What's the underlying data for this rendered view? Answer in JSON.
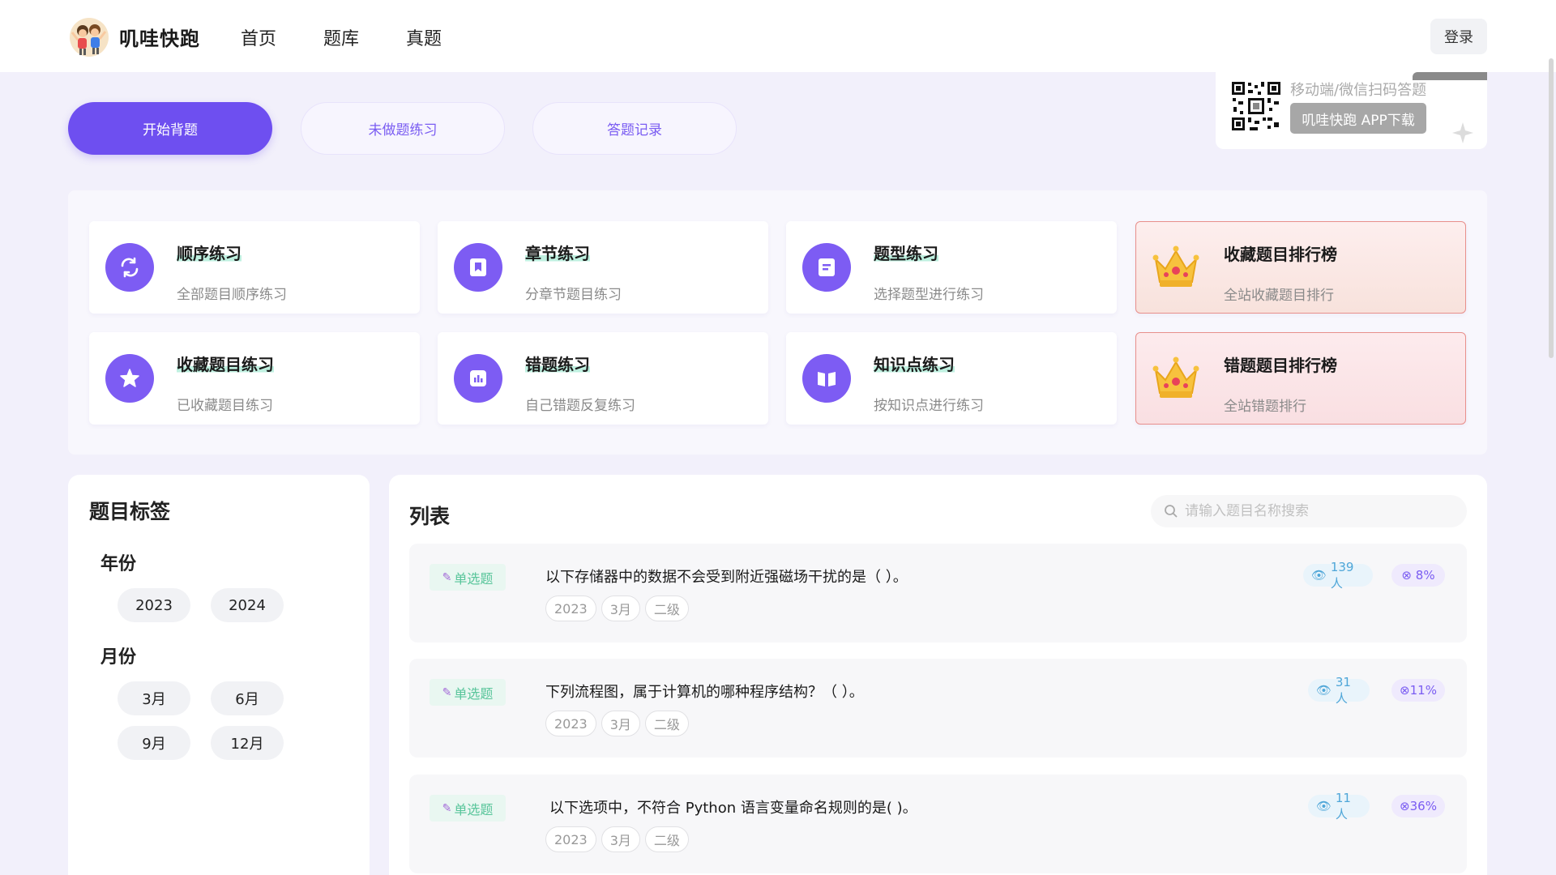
{
  "header": {
    "brand": "叽哇快跑",
    "nav": [
      "首页",
      "题库",
      "真题"
    ],
    "login": "登录"
  },
  "tabs": [
    "开始背题",
    "未做题练习",
    "答题记录"
  ],
  "qr": {
    "caption": "移动端/微信扫码答题",
    "download": "叽哇快跑 APP下载"
  },
  "practice": [
    {
      "title": "顺序练习",
      "sub": "全部题目顺序练习",
      "icon": "repeat-icon"
    },
    {
      "title": "章节练习",
      "sub": "分章节题目练习",
      "icon": "bookmark-icon"
    },
    {
      "title": "题型练习",
      "sub": "选择题型进行练习",
      "icon": "document-icon"
    },
    {
      "title": "收藏题目排行榜",
      "sub": "全站收藏题目排行",
      "icon": "crown-icon"
    },
    {
      "title": "收藏题目练习",
      "sub": "已收藏题目练习",
      "icon": "star-icon"
    },
    {
      "title": "错题练习",
      "sub": "自己错题反复练习",
      "icon": "bar-chart-icon"
    },
    {
      "title": "知识点练习",
      "sub": "按知识点进行练习",
      "icon": "book-icon"
    },
    {
      "title": "错题题目排行榜",
      "sub": "全站错题排行",
      "icon": "crown-icon"
    }
  ],
  "tags": {
    "title": "题目标签",
    "year_label": "年份",
    "years": [
      "2023",
      "2024"
    ],
    "month_label": "月份",
    "months": [
      "3月",
      "6月",
      "9月",
      "12月"
    ]
  },
  "list": {
    "title": "列表",
    "search_placeholder": "请输入题目名称搜索",
    "items": [
      {
        "type": "单选题",
        "text": "以下存储器中的数据不会受到附近强磁场干扰的是（    ）。",
        "tags": [
          "2023",
          "3月",
          "二级"
        ],
        "views": "139人",
        "rate": "8%"
      },
      {
        "type": "单选题",
        "text": "下列流程图，属于计算机的哪种程序结构？（    ）。",
        "tags": [
          "2023",
          "3月",
          "二级"
        ],
        "views": "31人",
        "rate": "11%"
      },
      {
        "type": "单选题",
        "text": "以下选项中，不符合 Python 语言变量命名规则的是( )。",
        "tags": [
          "2023",
          "3月",
          "二级"
        ],
        "views": "11人",
        "rate": "36%"
      }
    ]
  },
  "colors": {
    "accent": "#6e4ff0",
    "icon_bg": "#7d5cf3",
    "type_green": "#58c59a",
    "view_blue": "#4fa6d8"
  }
}
